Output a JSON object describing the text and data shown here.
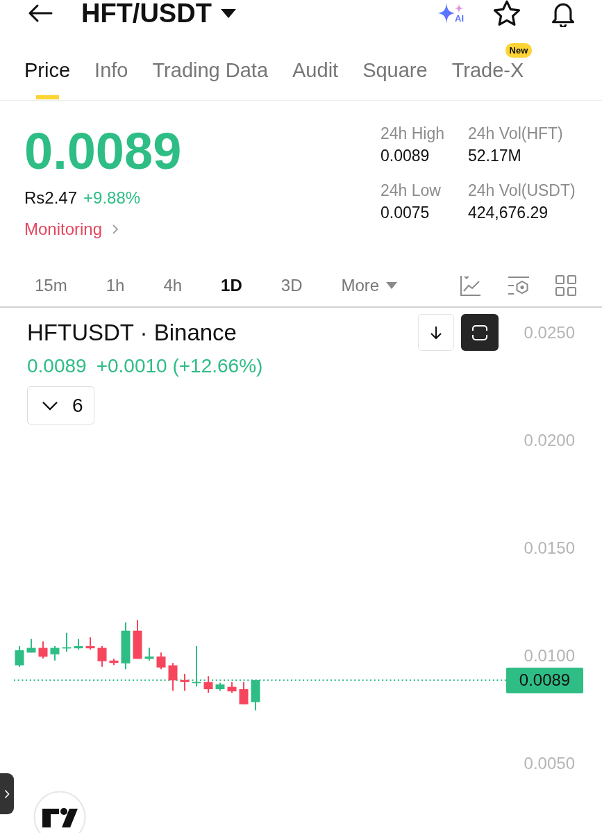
{
  "header": {
    "title": "HFT/USDT",
    "ai_label": "AI"
  },
  "tabs": [
    {
      "label": "Price",
      "selected": true
    },
    {
      "label": "Info",
      "selected": false
    },
    {
      "label": "Trading Data",
      "selected": false
    },
    {
      "label": "Audit",
      "selected": false
    },
    {
      "label": "Square",
      "selected": false
    },
    {
      "label": "Trade-X",
      "selected": false,
      "badge": "New"
    }
  ],
  "ticker": {
    "price": "0.0089",
    "fiat_price": "Rs2.47",
    "change": "+9.88%",
    "monitoring": "Monitoring"
  },
  "stats": [
    {
      "label": "24h High",
      "value": "0.0089"
    },
    {
      "label": "24h Vol(HFT)",
      "value": "52.17M"
    },
    {
      "label": "24h Low",
      "value": "0.0075"
    },
    {
      "label": "24h Vol(USDT)",
      "value": "424,676.29"
    }
  ],
  "intervals": {
    "items": [
      {
        "label": "15m",
        "selected": false
      },
      {
        "label": "1h",
        "selected": false
      },
      {
        "label": "4h",
        "selected": false
      },
      {
        "label": "1D",
        "selected": true
      },
      {
        "label": "3D",
        "selected": false
      }
    ],
    "more": "More"
  },
  "chart": {
    "symbol": "HFTUSDT · Binance",
    "last": "0.0089",
    "change": "+0.0010 (+12.66%)",
    "indicator_count": "6",
    "price_axis": [
      "0.0250",
      "0.0200",
      "0.0150",
      "0.0100",
      "0.0050"
    ],
    "price_tag": "0.0089"
  }
}
